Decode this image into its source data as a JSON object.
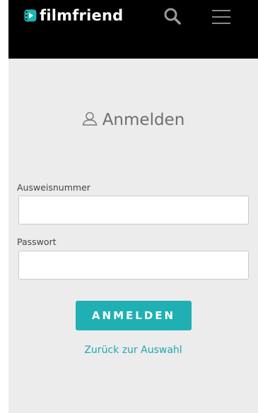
{
  "header": {
    "logo_text": "filmfriend",
    "search_icon": "search-icon",
    "menu_icon": "hamburger-menu-icon"
  },
  "login": {
    "title": "Anmelden",
    "title_icon": "user-icon",
    "id_label": "Ausweisnummer",
    "id_value": "",
    "password_label": "Passwort",
    "password_value": "",
    "submit_label": "ANMELDEN",
    "back_link": "Zurück zur Auswahl"
  },
  "colors": {
    "header_bg": "#000000",
    "accent": "#20b0b3",
    "page_bg": "#ececec",
    "logo_icon": "#1fb5b5"
  }
}
